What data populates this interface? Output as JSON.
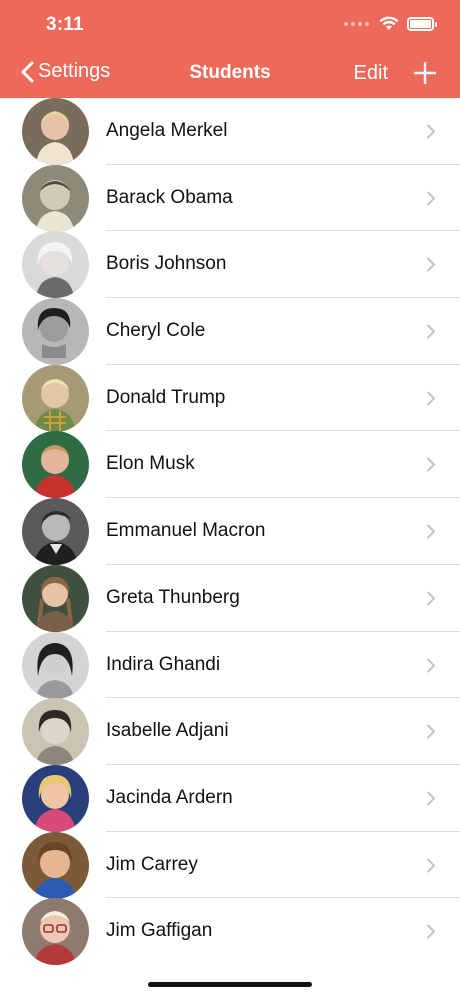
{
  "status_bar": {
    "time": "3:11"
  },
  "nav": {
    "back_label": "Settings",
    "title": "Students",
    "edit_label": "Edit",
    "add_icon": "plus-icon"
  },
  "colors": {
    "header": "#ed6a5a",
    "text": "#111111",
    "chevron": "#c4c4c4"
  },
  "students": [
    {
      "name": "Angela Merkel"
    },
    {
      "name": "Barack Obama"
    },
    {
      "name": "Boris Johnson"
    },
    {
      "name": "Cheryl Cole"
    },
    {
      "name": "Donald Trump"
    },
    {
      "name": "Elon Musk"
    },
    {
      "name": "Emmanuel Macron"
    },
    {
      "name": "Greta Thunberg"
    },
    {
      "name": "Indira Ghandi"
    },
    {
      "name": "Isabelle Adjani"
    },
    {
      "name": "Jacinda Ardern"
    },
    {
      "name": "Jim Carrey"
    },
    {
      "name": "Jim Gaffigan"
    }
  ]
}
